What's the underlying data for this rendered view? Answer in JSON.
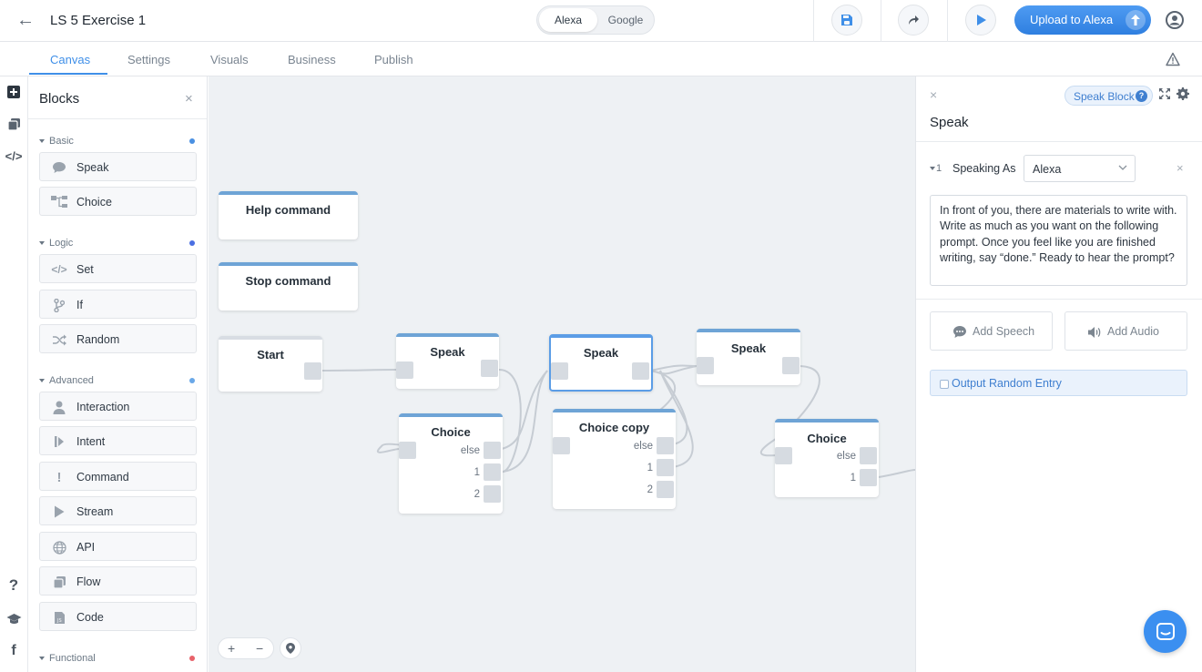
{
  "topbar": {
    "project_title": "LS 5 Exercise 1",
    "platforms": [
      "Alexa",
      "Google"
    ],
    "selected_platform": "Alexa",
    "upload_label": "Upload to Alexa",
    "accent_color": "#3f8fe8"
  },
  "tabs": [
    {
      "label": "Canvas",
      "active": true
    },
    {
      "label": "Settings",
      "active": false
    },
    {
      "label": "Visuals",
      "active": false
    },
    {
      "label": "Business",
      "active": false
    },
    {
      "label": "Publish",
      "active": false
    }
  ],
  "blocks_panel": {
    "title": "Blocks",
    "sections": [
      {
        "name": "Basic",
        "dot_color": "#4a90e2",
        "items": [
          {
            "label": "Speak",
            "icon": "speech-bubble-icon"
          },
          {
            "label": "Choice",
            "icon": "choice-branch-icon"
          }
        ]
      },
      {
        "name": "Logic",
        "dot_color": "#4a6fe2",
        "items": [
          {
            "label": "Set",
            "icon": "code-icon"
          },
          {
            "label": "If",
            "icon": "branch-icon"
          },
          {
            "label": "Random",
            "icon": "shuffle-icon"
          }
        ]
      },
      {
        "name": "Advanced",
        "dot_color": "#6aa8e8",
        "items": [
          {
            "label": "Interaction",
            "icon": "person-icon"
          },
          {
            "label": "Intent",
            "icon": "intent-icon"
          },
          {
            "label": "Command",
            "icon": "exclamation-icon"
          },
          {
            "label": "Stream",
            "icon": "play-icon"
          },
          {
            "label": "API",
            "icon": "globe-icon"
          },
          {
            "label": "Flow",
            "icon": "flow-icon"
          },
          {
            "label": "Code",
            "icon": "js-file-icon"
          }
        ]
      },
      {
        "name": "Functional",
        "dot_color": "#e8626a",
        "items": []
      }
    ]
  },
  "canvas": {
    "nodes": {
      "help_command": {
        "title": "Help command"
      },
      "stop_command": {
        "title": "Stop command"
      },
      "start": {
        "title": "Start"
      },
      "speak_1": {
        "title": "Speak"
      },
      "speak_2": {
        "title": "Speak"
      },
      "speak_3": {
        "title": "Speak"
      },
      "choice_1": {
        "title": "Choice",
        "ports": [
          "else",
          "1",
          "2"
        ]
      },
      "choice_copy": {
        "title": "Choice copy",
        "ports": [
          "else",
          "1",
          "2"
        ]
      },
      "choice_2": {
        "title": "Choice",
        "ports": [
          "else",
          "1"
        ]
      }
    },
    "zoom": {
      "plus": "+",
      "minus": "−"
    }
  },
  "editor": {
    "block_type_chip": "Speak Block",
    "title": "Speak",
    "speak_index": "1",
    "speaking_as_label": "Speaking As",
    "voice": "Alexa",
    "speech_text": "In front of you, there are materials to write with. Write as much as you want on the following prompt. Once you feel like you are finished writing, say “done.” Ready to hear the prompt?",
    "add_speech_label": "Add Speech",
    "add_audio_label": "Add Audio",
    "output_random_label": "Output Random Entry"
  }
}
